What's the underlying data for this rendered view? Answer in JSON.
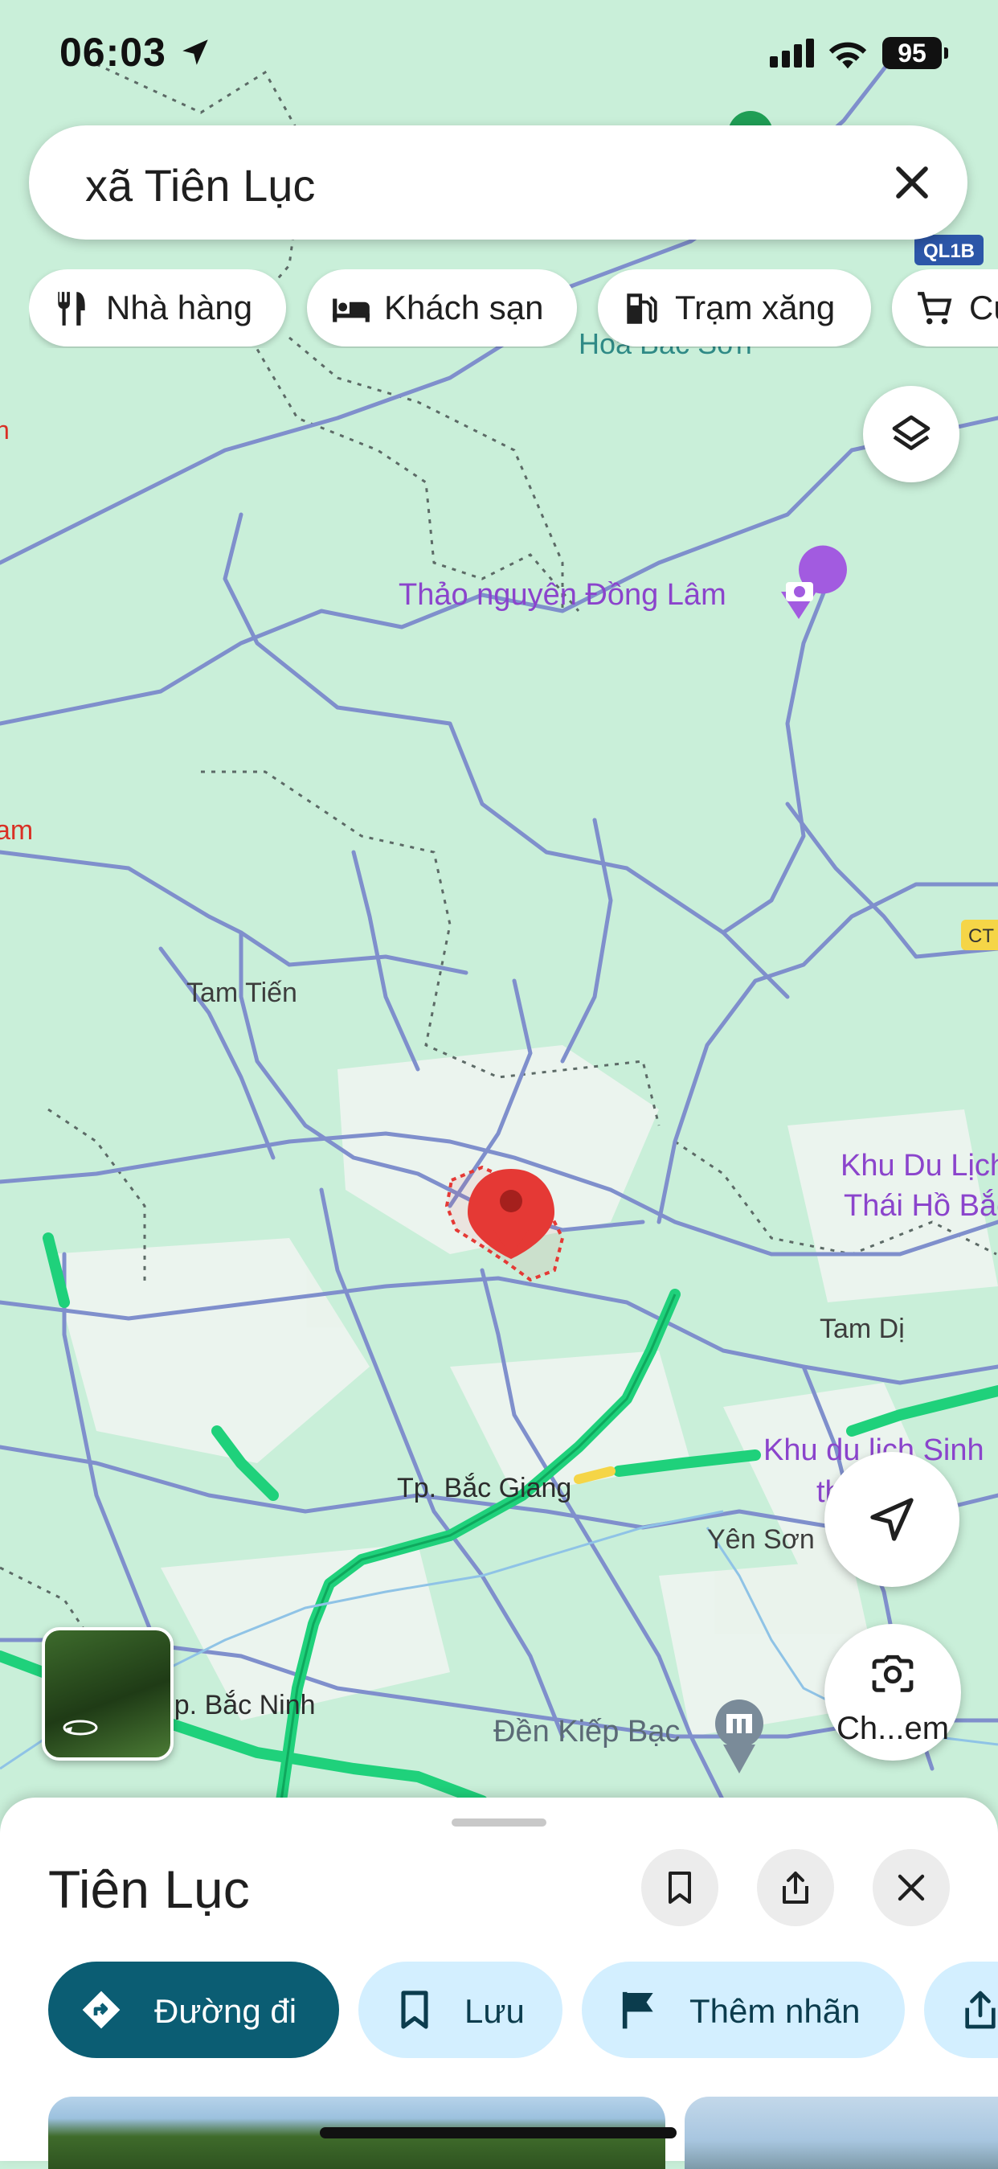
{
  "status_bar": {
    "time": "06:03",
    "battery": "95"
  },
  "search": {
    "query": "xã Tiên Lục"
  },
  "chips": [
    {
      "label": "Nhà hàng",
      "icon": "restaurant-icon"
    },
    {
      "label": "Khách sạn",
      "icon": "hotel-icon"
    },
    {
      "label": "Trạm xăng",
      "icon": "gas-station-icon"
    },
    {
      "label": "Cửa hàng",
      "icon": "shopping-cart-icon"
    }
  ],
  "map": {
    "labels": {
      "hoa_bac_son": "Hoa Bắc Sơn",
      "thao_nguyen": "Thảo nguyên Đồng Lâm",
      "tam_tien": "Tam Tiến",
      "khu_du_lich_1": "Khu Du Lịch",
      "khu_du_lich_1b": "Thái Hồ Bắc",
      "tam_di": "Tam Dị",
      "khu_du_lich_2": "Khu du lịch Sinh",
      "khu_du_lich_2b": "thái Mỹ",
      "bac_giang": "Tp. Bắc Giang",
      "yen_son": "Yên Sơn",
      "bac_ninh": "Tp. Bắc Ninh",
      "den_kiep_bac": "Đền Kiếp Bạc",
      "left_edge_1": "n",
      "left_edge_2": "am"
    },
    "road_badges": {
      "ql1b": "QL1B",
      "ct": "CT"
    },
    "colors": {
      "land": "#c9efd9",
      "road": "#7f8fcc",
      "highway": "#1fd17b",
      "pin": "#e53935",
      "boundary": "#e53935",
      "poi": "#a25be0"
    }
  },
  "controls": {
    "camera_label": "Ch...em"
  },
  "place_sheet": {
    "title": "Tiên Lục",
    "actions": [
      {
        "label": "Đường đi",
        "icon": "directions-icon"
      },
      {
        "label": "Lưu",
        "icon": "bookmark-icon"
      },
      {
        "label": "Thêm nhãn",
        "icon": "flag-icon"
      }
    ]
  }
}
